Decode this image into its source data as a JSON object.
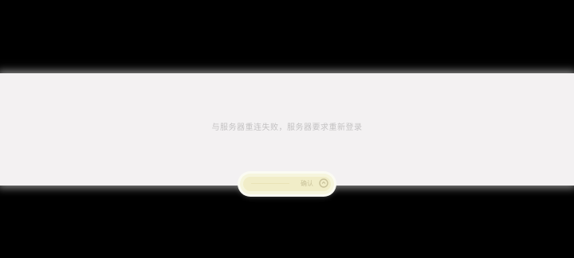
{
  "dialog": {
    "message": "与服务器重连失败，服务器要求重新登录",
    "confirm_label": "确认",
    "confirm_icon": "refresh-icon"
  },
  "colors": {
    "backdrop": "#000000",
    "panel": "#f3f1f2",
    "message_text": "#c4c2c3",
    "button_fill": "#f6f5dd",
    "button_text": "#c9c29a"
  }
}
